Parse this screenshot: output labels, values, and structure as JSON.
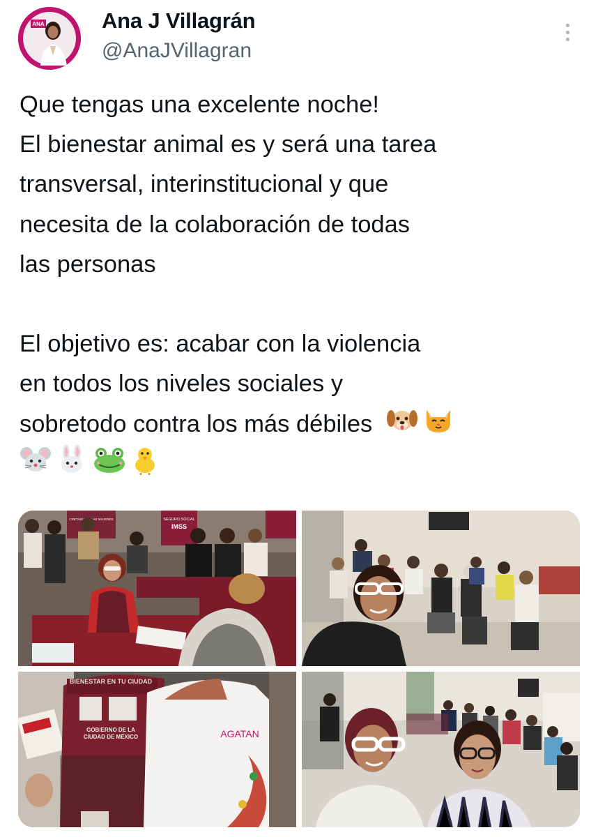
{
  "author": {
    "display_name": "Ana J Villagrán",
    "handle": "@AnaJVillagran",
    "avatar_badge": "ANA"
  },
  "tweet": {
    "lines": [
      "Que tengas una excelente noche!",
      "El bienestar animal es y será una tarea",
      "transversal, interinstitucional y que",
      "necesita de la colaboración de todas",
      "las personas",
      "",
      "El objetivo es: acabar con la violencia",
      "en todos los niveles sociales y",
      "sobretodo contra los más débiles"
    ],
    "emojis": [
      "dog-face",
      "cat-face",
      "mouse-face",
      "rabbit-face",
      "frog-face",
      "baby-chick"
    ]
  },
  "media": {
    "photos": [
      {
        "name": "photo-1",
        "printed_text": [
          "IMSS",
          "SEGURO SOCIAL",
          "CRETARÍA DE LAS MUJERES"
        ]
      },
      {
        "name": "photo-2",
        "printed_text": []
      },
      {
        "name": "photo-3",
        "printed_text": [
          "BIENESTAR EN TU CIUDAD",
          "GOBIERNO DE LA",
          "CIUDAD DE MÉXICO",
          "AGATAN"
        ]
      },
      {
        "name": "photo-4",
        "printed_text": []
      }
    ]
  },
  "colors": {
    "text": "#0f1419",
    "secondary": "#536471",
    "brand_magenta": "#c0136d",
    "vest_maroon": "#7a1f2b"
  }
}
